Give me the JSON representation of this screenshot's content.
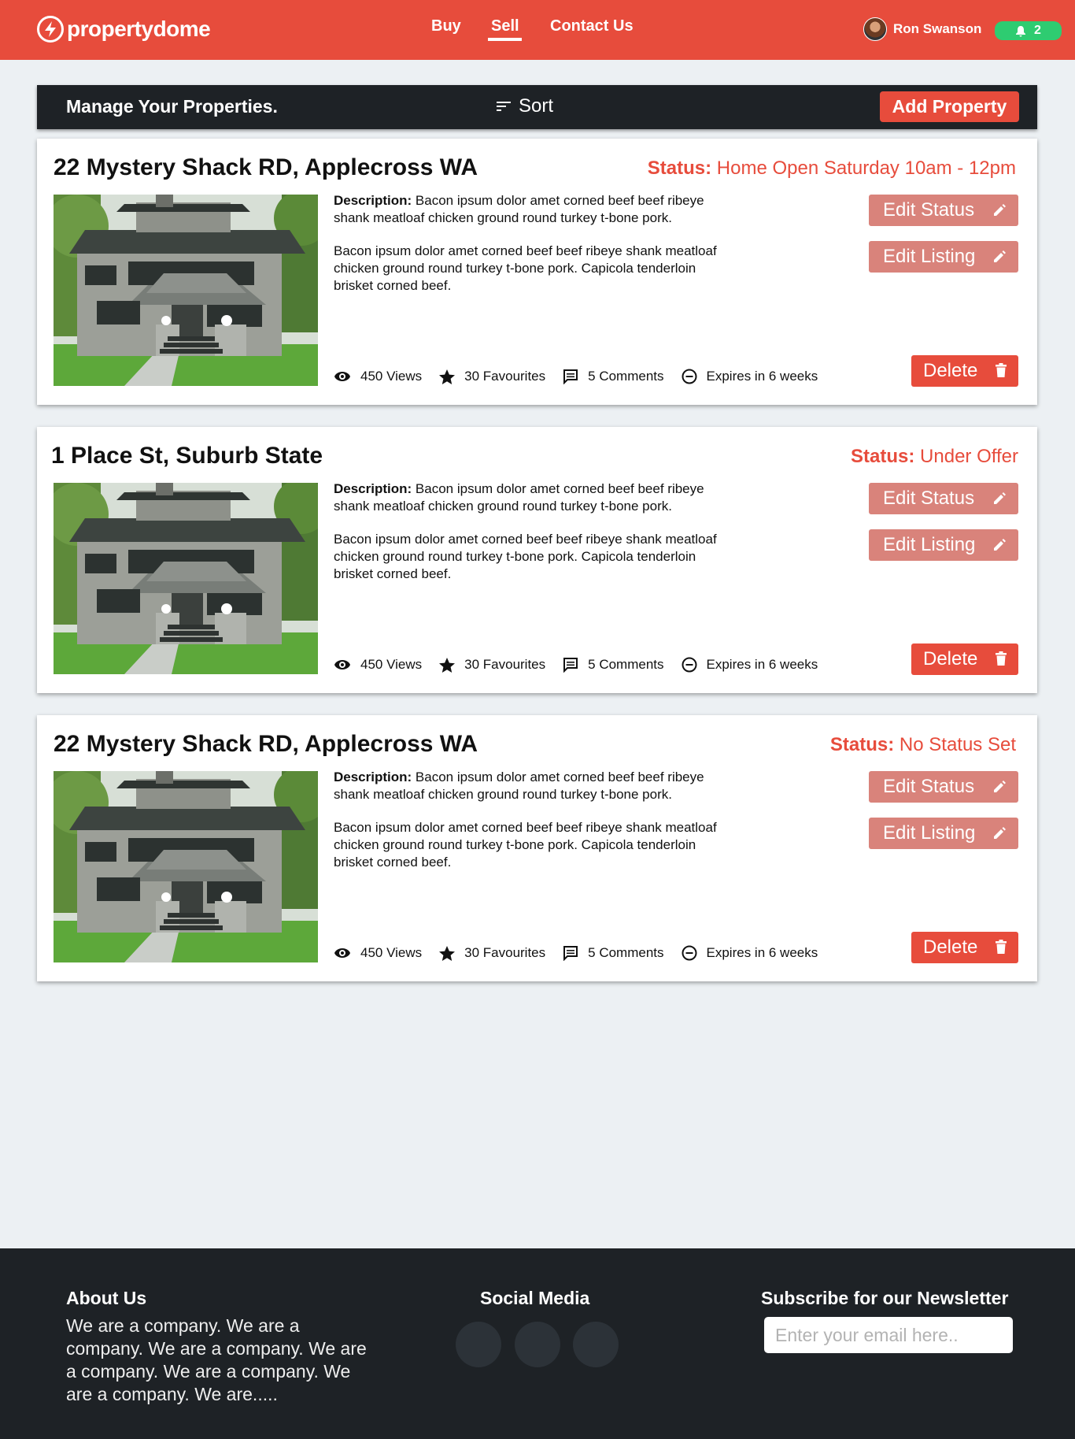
{
  "brand": {
    "name": "propertydome",
    "icon": "lightning-icon"
  },
  "nav": {
    "buy": "Buy",
    "sell": "Sell",
    "contact": "Contact Us",
    "active": "Sell"
  },
  "user": {
    "name": "Ron Swanson",
    "notifications": "2"
  },
  "toolbar": {
    "title": "Manage Your Properties.",
    "sort_label": "Sort",
    "add_label": "Add Property"
  },
  "labels": {
    "status_key": "Status:",
    "description_key": "Description:",
    "edit_status": "Edit Status",
    "edit_listing": "Edit Listing",
    "delete": "Delete"
  },
  "listings": [
    {
      "address": "22 Mystery Shack RD, Applecross WA",
      "status": "Home Open Saturday 10am - 12pm",
      "description": "Bacon ipsum dolor amet corned beef beef ribeye shank meatloaf chicken ground round turkey t-bone pork.",
      "extra": "Bacon ipsum dolor amet corned beef beef ribeye shank meatloaf chicken ground round turkey t-bone pork. Capicola tenderloin brisket corned beef.",
      "views": "450 Views",
      "favourites": "30 Favourites",
      "comments": "5 Comments",
      "expires": "Expires in 6 weeks"
    },
    {
      "address": "1 Place St, Suburb State",
      "status": "Under Offer",
      "description": "Bacon ipsum dolor amet corned beef beef ribeye shank meatloaf chicken ground round turkey t-bone pork.",
      "extra": "Bacon ipsum dolor amet corned beef beef ribeye shank meatloaf chicken ground round turkey t-bone pork. Capicola tenderloin brisket corned beef.",
      "views": "450 Views",
      "favourites": "30 Favourites",
      "comments": "5 Comments",
      "expires": "Expires in 6 weeks"
    },
    {
      "address": "22 Mystery Shack RD, Applecross WA",
      "status": "No Status Set",
      "description": "Bacon ipsum dolor amet corned beef beef ribeye shank meatloaf chicken ground round turkey t-bone pork.",
      "extra": "Bacon ipsum dolor amet corned beef beef ribeye shank meatloaf chicken ground round turkey t-bone pork. Capicola tenderloin brisket corned beef.",
      "views": "450 Views",
      "favourites": "30 Favourites",
      "comments": "5 Comments",
      "expires": "Expires in 6 weeks"
    }
  ],
  "footer": {
    "about_title": "About Us",
    "about_text": "We are a company. We are a company. We are a company. We are a company. We are a company. We are a company. We are.....",
    "social_title": "Social Media",
    "newsletter_title": "Subscribe for our Newsletter",
    "email_placeholder": "Enter your email here.."
  },
  "colors": {
    "brand_red": "#e74c3c",
    "soft_red": "#d9837b",
    "dark": "#1e2226",
    "notif_green": "#2ecc71",
    "page_bg": "#ecf0f3"
  }
}
